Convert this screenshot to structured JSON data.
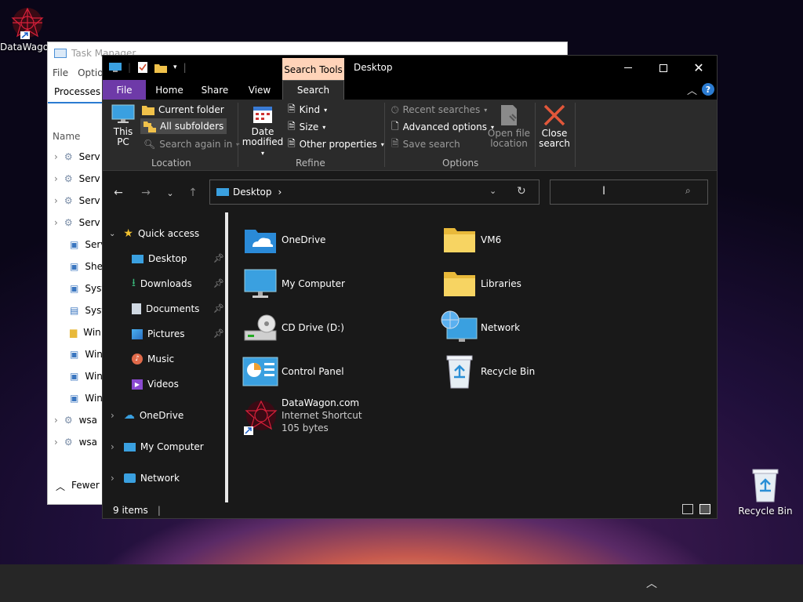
{
  "desktop": {
    "icons": [
      {
        "label": "DataWagon.com"
      },
      {
        "label": "Recycle Bin"
      }
    ]
  },
  "taskmanager": {
    "title": "Task Manager",
    "menu": [
      "File",
      "Options"
    ],
    "tab": "Processes",
    "column": "Name",
    "rows": [
      "Serv",
      "Serv",
      "Serv",
      "Serv",
      "Serv",
      "She",
      "Syst",
      "Syst",
      "Win",
      "Win",
      "Win",
      "Win",
      "wsa",
      "wsa"
    ],
    "fewer": "Fewer details"
  },
  "explorer": {
    "title": "Desktop",
    "context_tab": "Search Tools",
    "tabs": [
      "File",
      "Home",
      "Share",
      "View",
      "Search"
    ],
    "ribbon": {
      "this_pc": "This PC",
      "current_folder": "Current folder",
      "all_subfolders": "All subfolders",
      "search_again": "Search again in",
      "location_label": "Location",
      "date_modified": "Date modified",
      "kind": "Kind",
      "size": "Size",
      "other_properties": "Other properties",
      "refine_label": "Refine",
      "recent_searches": "Recent searches",
      "advanced_options": "Advanced options",
      "save_search": "Save search",
      "open_file_location": "Open file location",
      "options_label": "Options",
      "close_search": "Close search"
    },
    "address": "Desktop",
    "search_placeholder": "",
    "navpane": {
      "quick_access": "Quick access",
      "items": [
        "Desktop",
        "Downloads",
        "Documents",
        "Pictures",
        "Music",
        "Videos"
      ],
      "onedrive": "OneDrive",
      "mycomputer": "My Computer",
      "network": "Network"
    },
    "files": [
      {
        "name": "OneDrive"
      },
      {
        "name": "VM6"
      },
      {
        "name": "My Computer"
      },
      {
        "name": "Libraries"
      },
      {
        "name": "CD Drive (D:)"
      },
      {
        "name": "Network"
      },
      {
        "name": "Control Panel"
      },
      {
        "name": "Recycle Bin"
      },
      {
        "name": "DataWagon.com",
        "type": "Internet Shortcut",
        "size": "105 bytes"
      }
    ],
    "status": "9 items",
    "accent": "#6e3aa8",
    "context_color": "#ffd3b8"
  }
}
